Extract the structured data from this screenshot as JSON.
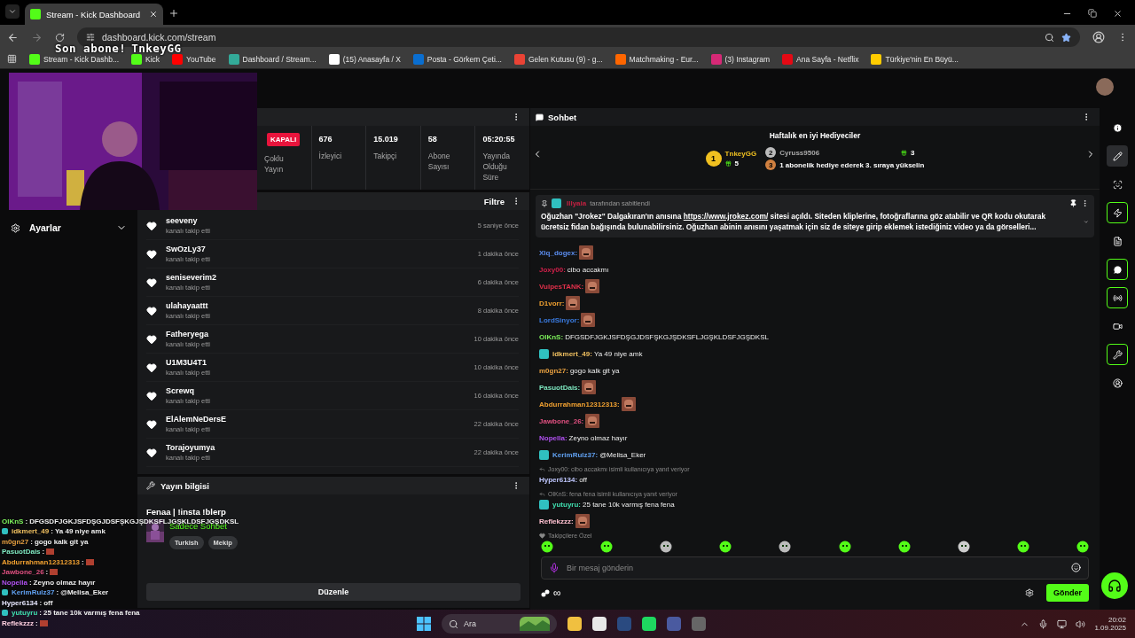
{
  "browser": {
    "tab_title": "Stream - Kick Dashboard",
    "url": "dashboard.kick.com/stream",
    "bookmarks": [
      "Stream - Kick Dashb...",
      "Kick",
      "YouTube",
      "Dashboard / Stream...",
      "(15) Anasayfa / X",
      "Posta - Görkem Çeti...",
      "Gelen Kutusu (9) - g...",
      "Matchmaking - Eur...",
      "(3) Instagram",
      "Ana Sayfa - Netflix",
      "Türkiye'nin En Büyü..."
    ]
  },
  "overlay": {
    "last_sub_label": "Son abone!",
    "last_sub_name": "TnkeyGG",
    "separator": ":",
    "chat": [
      {
        "user": "OlKnS",
        "color": "#7cf05a",
        "kind": "text",
        "text": "DFGSDFJGKJSFDŞGJDSFŞKGJŞDKSFLJGŞKLDSFJGŞDKSL"
      },
      {
        "user": "idkmert_49",
        "color": "#f0c060",
        "kind": "text",
        "text": "Ya 49 niye amk",
        "badge": true
      },
      {
        "user": "m0gn27",
        "color": "#e8a040",
        "kind": "text",
        "text": "gogo kalk git ya"
      },
      {
        "user": "PasuotDais",
        "color": "#7ee8c0",
        "kind": "emote"
      },
      {
        "user": "Abdurrahman12312313",
        "color": "#f0a030",
        "kind": "emote"
      },
      {
        "user": "Jawbone_26",
        "color": "#e05080",
        "kind": "emote"
      },
      {
        "user": "Nopella",
        "color": "#b050f0",
        "kind": "text",
        "text": "Zeyno olmaz hayır"
      },
      {
        "user": "KerimRulz37",
        "color": "#60a0f0",
        "kind": "text",
        "text": "@Melisa_Eker",
        "badge": true
      },
      {
        "user": "Hyper6134",
        "color": "#e8e8ff",
        "kind": "text",
        "text": "off"
      },
      {
        "user": "yutuyru",
        "color": "#40e0b0",
        "kind": "text",
        "text": "25 tane 10k varmış fena fena",
        "badge": true
      },
      {
        "user": "Reflekzzz",
        "color": "#ffd0e0",
        "kind": "emote"
      }
    ]
  },
  "sidebar": {
    "settings_label": "Ayarlar"
  },
  "stats": [
    {
      "kind": "badge",
      "value": "KAPALI",
      "label": "Çoklu Yayın"
    },
    {
      "kind": "value",
      "value": "676",
      "label": "İzleyici"
    },
    {
      "kind": "value",
      "value": "15.019",
      "label": "Takipçi"
    },
    {
      "kind": "value",
      "value": "58",
      "label": "Abone Sayısı"
    },
    {
      "kind": "value",
      "value": "05:20:55",
      "label": "Yayında Olduğu Süre"
    }
  ],
  "activity": {
    "filter_label": "Filtre",
    "items": [
      {
        "user": "seeveny",
        "action": "kanalı takip etti",
        "time": "5 saniye önce"
      },
      {
        "user": "SwOzLy37",
        "action": "kanalı takip etti",
        "time": "1 dakika önce"
      },
      {
        "user": "seniseverim2",
        "action": "kanalı takip etti",
        "time": "6 dakika önce"
      },
      {
        "user": "ulahayaattt",
        "action": "kanalı takip etti",
        "time": "8 dakika önce"
      },
      {
        "user": "Fatheryega",
        "action": "kanalı takip etti",
        "time": "10 dakika önce"
      },
      {
        "user": "U1M3U4T1",
        "action": "kanalı takip etti",
        "time": "10 dakika önce"
      },
      {
        "user": "Screwq",
        "action": "kanalı takip etti",
        "time": "16 dakika önce"
      },
      {
        "user": "ElAlemNeDersE",
        "action": "kanalı takip etti",
        "time": "22 dakika önce"
      },
      {
        "user": "Torajoyumya",
        "action": "kanalı takip etti",
        "time": "22 dakika önce"
      }
    ]
  },
  "stream_info": {
    "heading": "Yayın bilgisi",
    "title": "Fenaa | !insta !blerp",
    "category": "Sadece Sohbet",
    "tags": [
      "Turkish",
      "Mekip"
    ],
    "edit_button": "Düzenle"
  },
  "chat": {
    "heading": "Sohbet",
    "separator": ":",
    "gifters": {
      "heading": "Haftalık en iyi Hediyeciler",
      "first": {
        "rank": "1",
        "name": "TnkeyGG",
        "count": "5"
      },
      "second": {
        "rank": "2",
        "name": "Cyruss9506",
        "count": "3"
      },
      "third": {
        "rank": "3",
        "text": "1 abonelik hediye ederek 3. sıraya yükselin"
      }
    },
    "pinned": {
      "by": "Illyaia",
      "by_suffix": "tarafından sabitlendi",
      "text_before": "Oğuzhan \"Jrokez\" Dalgakıran'ın anısına ",
      "link": "https://www.jrokez.com/",
      "text_after": " sitesi açıldı. Siteden kliplerine, fotoğraflarına göz atabilir ve QR kodu okutarak ücretsiz fidan bağışında bulunabilirsiniz. Oğuzhan abinin anısını yaşatmak için siz de siteye girip eklemek istediğiniz video ya da görselleri..."
    },
    "messages": [
      {
        "user": "Xlq_dogex",
        "color": "#5b8def",
        "kind": "emote"
      },
      {
        "user": "Joxy00",
        "color": "#d0204a",
        "kind": "text",
        "text": "cibo accakmı"
      },
      {
        "user": "VulpesTANK",
        "color": "#e0304a",
        "kind": "emote"
      },
      {
        "user": "D1vorr",
        "color": "#f0a030",
        "kind": "emote"
      },
      {
        "user": "LordSinyor",
        "color": "#3a7be0",
        "kind": "emote"
      },
      {
        "user": "OlKnS",
        "color": "#7cf05a",
        "kind": "text",
        "text": "DFGSDFJGKJSFDŞGJDSFŞKGJŞDKSFLJGŞKLDSFJGŞDKSL"
      },
      {
        "user": "idkmert_49",
        "color": "#f0c060",
        "kind": "text",
        "text": "Ya 49 niye amk",
        "badge": true
      },
      {
        "user": "m0gn27",
        "color": "#e8a040",
        "kind": "text",
        "text": "gogo kalk git ya"
      },
      {
        "user": "PasuotDais",
        "color": "#7ee8c0",
        "kind": "emote"
      },
      {
        "user": "Abdurrahman12312313",
        "color": "#f0a030",
        "kind": "emote"
      },
      {
        "user": "Jawbone_26",
        "color": "#e05080",
        "kind": "emote"
      },
      {
        "user": "Nopella",
        "color": "#b050f0",
        "kind": "text",
        "text": "Zeyno olmaz hayır"
      },
      {
        "user": "KerimRulz37",
        "color": "#60a0f0",
        "kind": "text",
        "text": "@Melisa_Eker",
        "badge": true
      },
      {
        "user": "Hyper6134",
        "color": "#c0c8ff",
        "kind": "text",
        "text": "off",
        "reply": "Joxy00: cibo accakmı isimli kullanıcıya yanıt veriyor"
      },
      {
        "user": "yutuyru",
        "color": "#40e0b0",
        "kind": "text",
        "text": "25 tane 10k varmış fena fena",
        "badge": true,
        "reply": "OlKnS: fena fena isimli kullanıcıya yanıt veriyor"
      },
      {
        "user": "Reflekzzz",
        "color": "#ffc0d0",
        "kind": "emote"
      }
    ],
    "emote_set_label": "Takipçilere Özel",
    "input": {
      "placeholder": "Bir mesaj gönderin"
    },
    "points": "∞",
    "send_button": "Gönder"
  },
  "rail": [
    {
      "selected": false,
      "active": false
    },
    {
      "selected": true,
      "active": false
    },
    {
      "selected": false,
      "active": false
    },
    {
      "selected": false,
      "active": true
    },
    {
      "selected": false,
      "active": false
    },
    {
      "selected": false,
      "active": true
    },
    {
      "selected": false,
      "active": true
    },
    {
      "selected": false,
      "active": false
    },
    {
      "selected": false,
      "active": true
    },
    {
      "selected": false,
      "active": false
    }
  ],
  "taskbar": {
    "search_placeholder": "Ara",
    "time": "20:02",
    "date": "1.09.2025"
  }
}
